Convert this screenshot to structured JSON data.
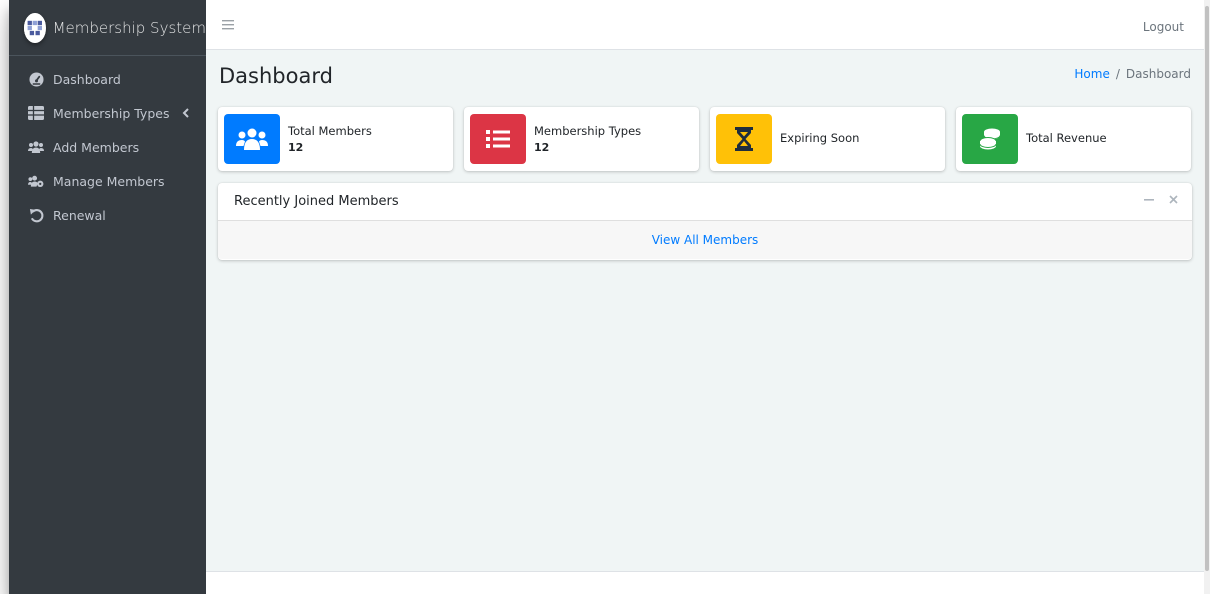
{
  "brand": {
    "name": "Membership System",
    "logo_icon": "members-logo-icon"
  },
  "sidebar": {
    "items": [
      {
        "label": "Dashboard",
        "icon": "tachometer-icon"
      },
      {
        "label": "Membership Types",
        "icon": "table-icon",
        "has_submenu": true
      },
      {
        "label": "Add Members",
        "icon": "users-icon"
      },
      {
        "label": "Manage Members",
        "icon": "users-cog-icon"
      },
      {
        "label": "Renewal",
        "icon": "undo-icon"
      }
    ]
  },
  "topbar": {
    "menu_icon": "bars-icon",
    "logout_label": "Logout"
  },
  "page": {
    "title": "Dashboard",
    "breadcrumb": {
      "home": "Home",
      "current": "Dashboard"
    }
  },
  "info_boxes": [
    {
      "label": "Total Members",
      "value": "12",
      "color": "#007bff",
      "icon": "users-icon"
    },
    {
      "label": "Membership Types",
      "value": "12",
      "color": "#dc3545",
      "icon": "list-icon"
    },
    {
      "label": "Expiring Soon",
      "value": "",
      "color": "#ffc107",
      "icon": "hourglass-icon"
    },
    {
      "label": "Total Revenue",
      "value": "",
      "color": "#28a745",
      "icon": "coins-icon"
    }
  ],
  "recent_card": {
    "title": "Recently Joined Members",
    "minimize_icon": "minus-icon",
    "close_icon": "times-icon",
    "footer_link": "View All Members"
  },
  "colors": {
    "sidebar_bg": "#343a40",
    "content_bg": "#f0f5f5",
    "link": "#007bff"
  }
}
